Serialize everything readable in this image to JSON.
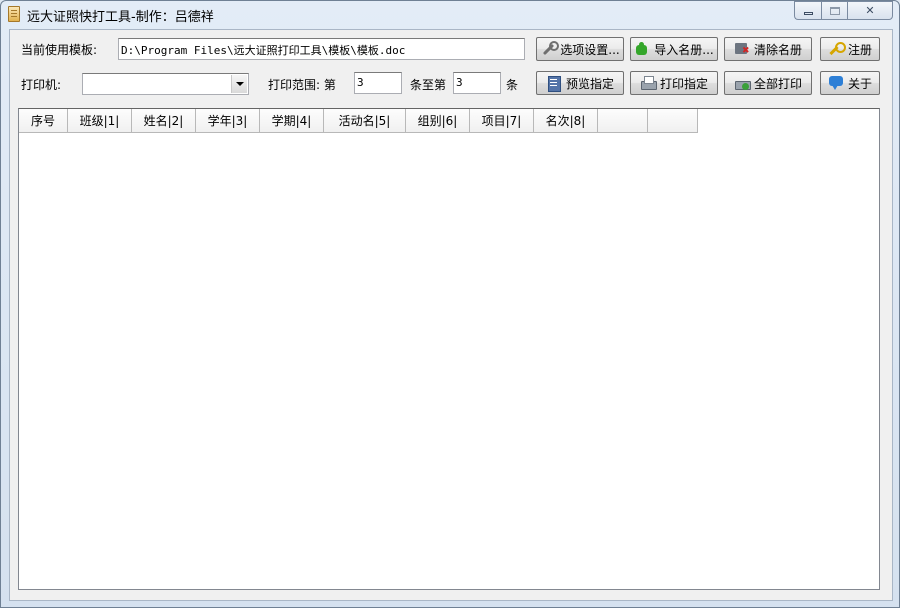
{
  "window": {
    "title": "远大证照快打工具-制作：吕德祥"
  },
  "template": {
    "label": "当前使用模板:",
    "path": "D:\\Program Files\\远大证照打印工具\\模板\\模板.doc"
  },
  "printer": {
    "label": "打印机:",
    "selected": ""
  },
  "range": {
    "label": "打印范围: 第",
    "from": "3",
    "mid_label": "条至第",
    "to": "3",
    "end_label": "条"
  },
  "toolbar": {
    "options_label": "选项设置...",
    "import_label": "导入名册...",
    "clear_label": "清除名册",
    "register_label": "注册",
    "preview_label": "预览指定",
    "print_selected_label": "打印指定",
    "print_all_label": "全部打印",
    "about_label": "关于"
  },
  "grid": {
    "columns": [
      "序号",
      "班级|1|",
      "姓名|2|",
      "学年|3|",
      "学期|4|",
      "活动名|5|",
      "组别|6|",
      "项目|7|",
      "名次|8|",
      "",
      ""
    ],
    "rows": []
  }
}
